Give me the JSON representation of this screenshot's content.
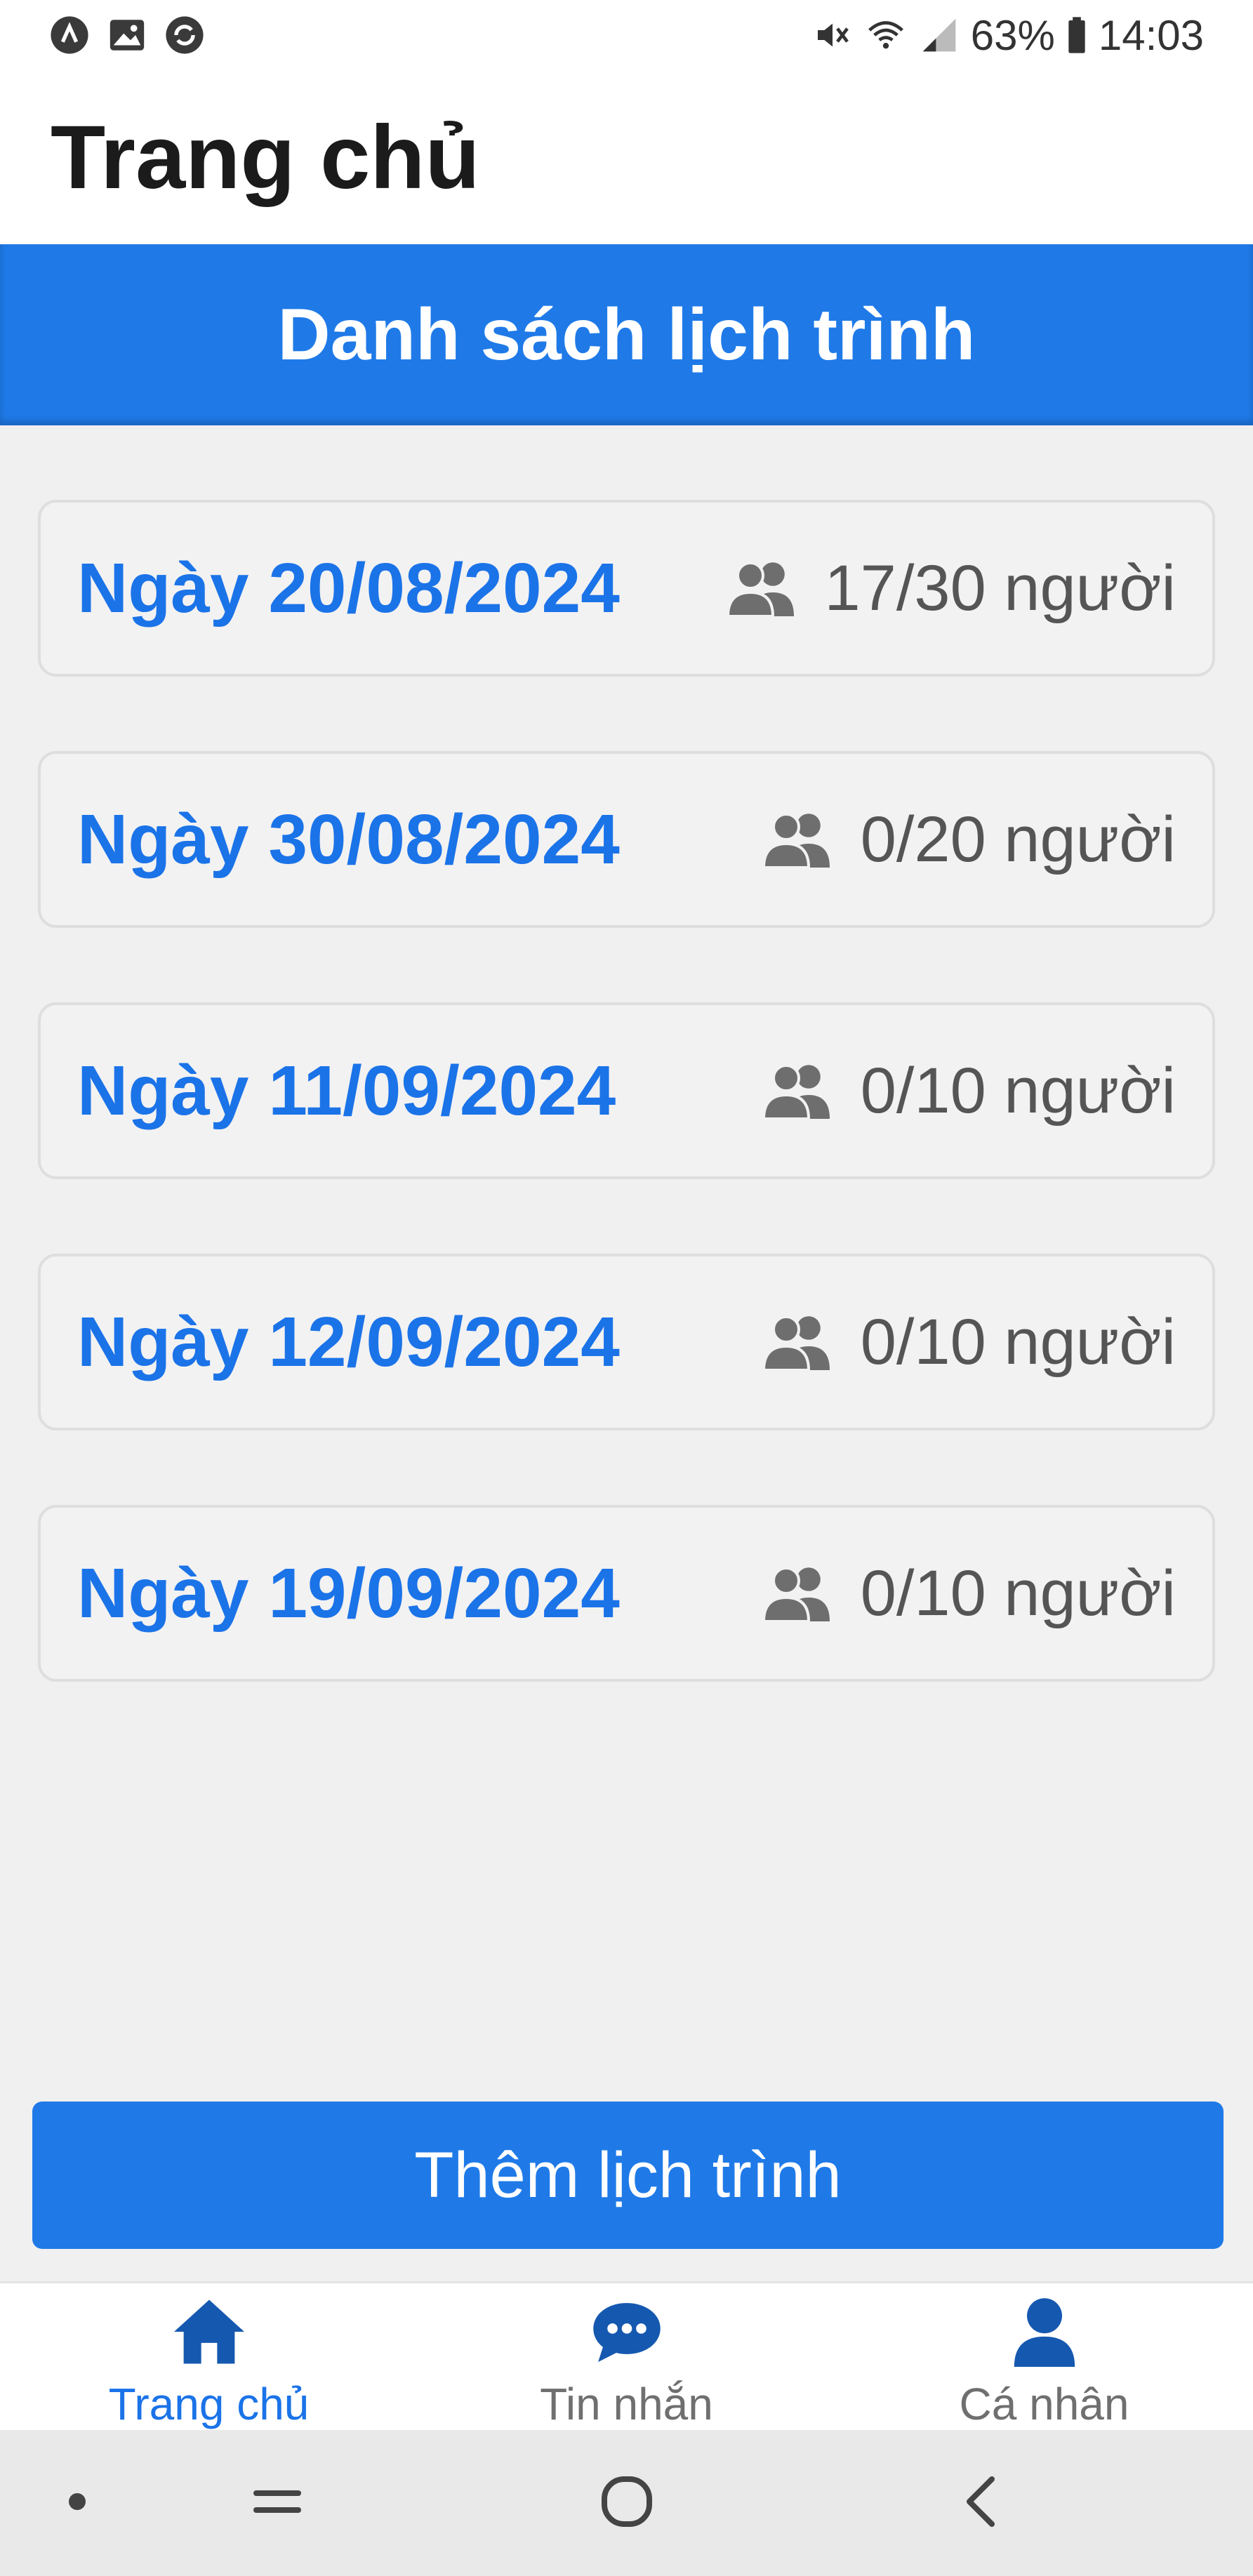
{
  "status_bar": {
    "left_icons": [
      "app-a-icon",
      "image-icon",
      "sync-icon"
    ],
    "battery_percent": "63%",
    "time": "14:03",
    "right_icons": [
      "mute-icon",
      "wifi-icon",
      "signal-icon",
      "battery-icon"
    ]
  },
  "header": {
    "title": "Trang chủ"
  },
  "section": {
    "title": "Danh sách lịch trình"
  },
  "schedules": [
    {
      "date": "Ngày 20/08/2024",
      "count": "17/30 người"
    },
    {
      "date": "Ngày 30/08/2024",
      "count": "0/20 người"
    },
    {
      "date": "Ngày 11/09/2024",
      "count": "0/10 người"
    },
    {
      "date": "Ngày 12/09/2024",
      "count": "0/10 người"
    },
    {
      "date": "Ngày 19/09/2024",
      "count": "0/10 người"
    }
  ],
  "add_button": {
    "label": "Thêm lịch trình"
  },
  "bottom_nav": {
    "items": [
      {
        "label": "Trang chủ",
        "icon": "home-icon",
        "active": true
      },
      {
        "label": "Tin nhắn",
        "icon": "chat-icon",
        "active": false
      },
      {
        "label": "Cá nhân",
        "icon": "person-icon",
        "active": false
      }
    ]
  },
  "colors": {
    "primary": "#1f7ae8",
    "date_text": "#1b73e8",
    "nav_icon": "#1558b0",
    "inactive_label": "#6f6f6f"
  }
}
